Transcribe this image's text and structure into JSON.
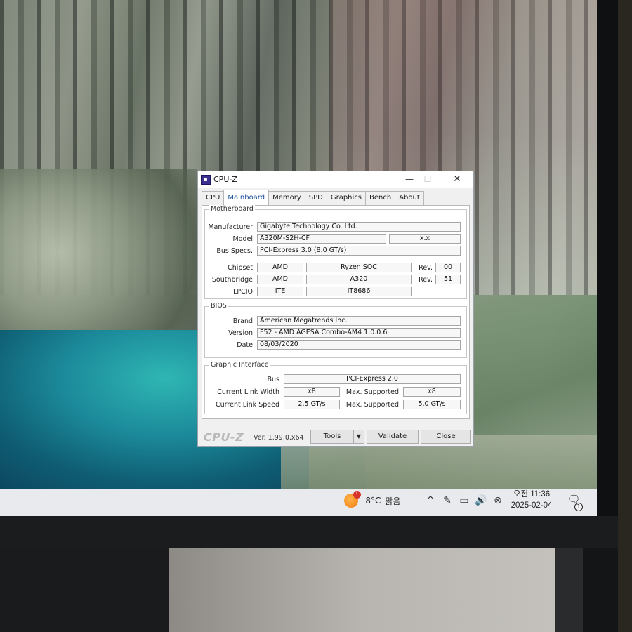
{
  "window": {
    "app_title": "CPU-Z",
    "minimize": "—",
    "maximize": "☐",
    "close": "✕"
  },
  "tabs": [
    "CPU",
    "Mainboard",
    "Memory",
    "SPD",
    "Graphics",
    "Bench",
    "About"
  ],
  "active_tab": "Mainboard",
  "motherboard": {
    "title": "Motherboard",
    "manufacturer_label": "Manufacturer",
    "manufacturer": "Gigabyte Technology Co. Ltd.",
    "model_label": "Model",
    "model": "A320M-S2H-CF",
    "model_rev": "x.x",
    "bus_specs_label": "Bus Specs.",
    "bus_specs": "PCI-Express 3.0 (8.0 GT/s)",
    "chipset_label": "Chipset",
    "chipset_vendor": "AMD",
    "chipset_model": "Ryzen SOC",
    "chipset_rev_label": "Rev.",
    "chipset_rev": "00",
    "southbridge_label": "Southbridge",
    "southbridge_vendor": "AMD",
    "southbridge_model": "A320",
    "southbridge_rev_label": "Rev.",
    "southbridge_rev": "51",
    "lpcio_label": "LPCIO",
    "lpcio_vendor": "ITE",
    "lpcio_model": "IT8686"
  },
  "bios": {
    "title": "BIOS",
    "brand_label": "Brand",
    "brand": "American Megatrends Inc.",
    "version_label": "Version",
    "version": "F52 - AMD AGESA Combo-AM4 1.0.0.6",
    "date_label": "Date",
    "date": "08/03/2020"
  },
  "graphic_interface": {
    "title": "Graphic Interface",
    "bus_label": "Bus",
    "bus": "PCI-Express 2.0",
    "link_width_label": "Current Link Width",
    "link_width": "x8",
    "max_width_label": "Max. Supported",
    "max_width": "x8",
    "link_speed_label": "Current Link Speed",
    "link_speed": "2.5 GT/s",
    "max_speed_label": "Max. Supported",
    "max_speed": "5.0 GT/s"
  },
  "footer": {
    "logo": "CPU-Z",
    "version": "Ver. 1.99.0.x64",
    "tools_label": "Tools",
    "tools_arrow": "▼",
    "validate_label": "Validate",
    "close_label": "Close"
  },
  "taskbar": {
    "weather_badge": "1",
    "temperature": "-8°C",
    "condition": "맑음",
    "tray_icons": [
      "chevron-up-icon",
      "pen-icon",
      "network-icon",
      "volume-icon",
      "mute-icon"
    ],
    "tray_glyphs": [
      "^",
      "✎",
      "▭",
      "🔊",
      "⊗"
    ],
    "time": "오전 11:36",
    "date": "2025-02-04",
    "notification_count": "1",
    "notification_glyph": "🗨"
  }
}
